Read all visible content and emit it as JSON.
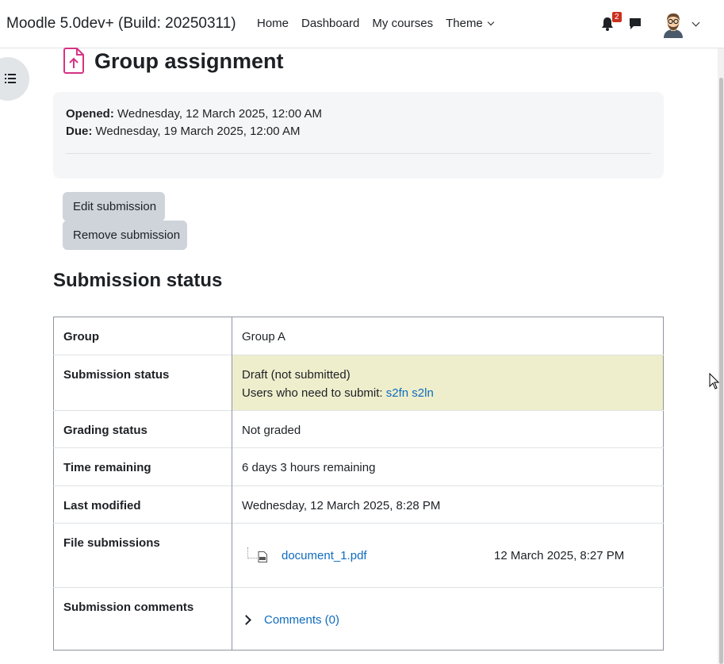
{
  "navbar": {
    "brand": "Moodle 5.0dev+ (Build: 20250311)",
    "links": [
      "Home",
      "Dashboard",
      "My courses",
      "Theme"
    ],
    "notification_count": "2",
    "icons": [
      "bell-icon",
      "chat-icon",
      "avatar",
      "chevron-down-icon"
    ]
  },
  "header": {
    "title": "Group assignment",
    "icon": "assignment-upload-icon",
    "accent_color": "#d63384"
  },
  "dates": {
    "opened_label": "Opened:",
    "opened_value": "Wednesday, 12 March 2025, 12:00 AM",
    "due_label": "Due:",
    "due_value": "Wednesday, 19 March 2025, 12:00 AM"
  },
  "actions": {
    "edit_label": "Edit submission",
    "remove_label": "Remove submission"
  },
  "submission": {
    "section_title": "Submission status",
    "rows": {
      "group": {
        "label": "Group",
        "value": "Group A"
      },
      "status": {
        "label": "Submission status",
        "value": "Draft (not submitted)",
        "need_prefix": "Users who need to submit:",
        "need_users": "s2fn s2ln",
        "highlight_color": "#eeeecc"
      },
      "grading": {
        "label": "Grading status",
        "value": "Not graded"
      },
      "time": {
        "label": "Time remaining",
        "value": "6 days 3 hours remaining"
      },
      "modified": {
        "label": "Last modified",
        "value": "Wednesday, 12 March 2025, 8:28 PM"
      },
      "files": {
        "label": "File submissions",
        "file_name": "document_1.pdf",
        "file_date": "12 March 2025, 8:27 PM",
        "file_icon": "pdf-file-icon"
      },
      "comments": {
        "label": "Submission comments",
        "link": "Comments (0)"
      }
    }
  },
  "colors": {
    "link": "#0f6cbf",
    "button_bg": "#ced4da",
    "badge": "#ca3120"
  }
}
